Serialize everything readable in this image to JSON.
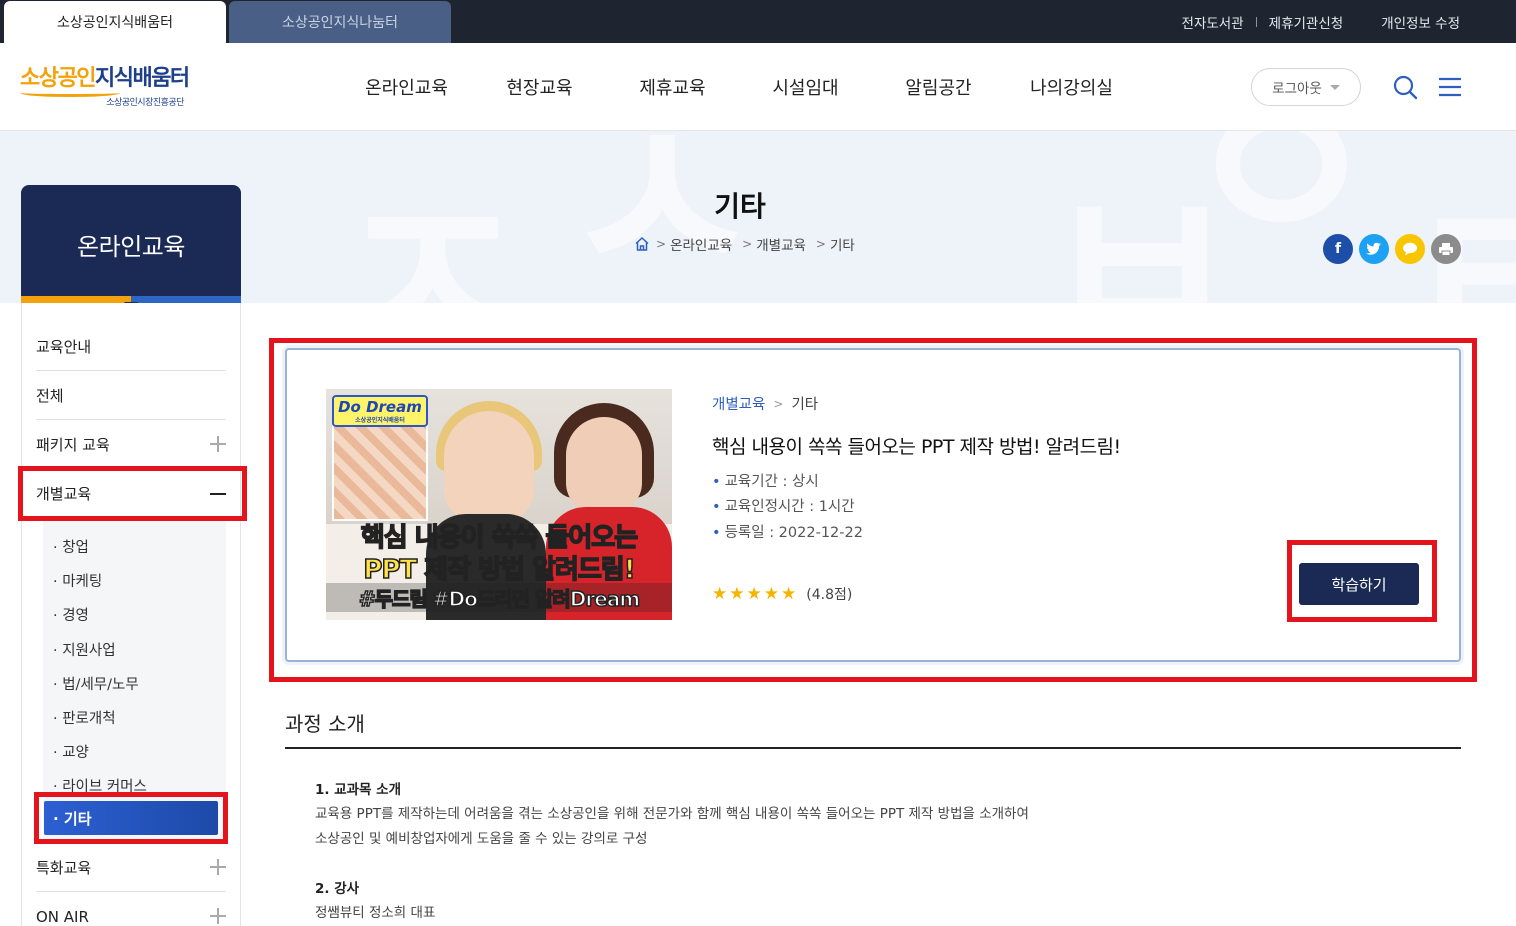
{
  "top_tabs": [
    {
      "label": "소상공인지식배움터",
      "active": true
    },
    {
      "label": "소상공인지식나눔터",
      "active": false
    }
  ],
  "top_links": [
    "전자도서관",
    "제휴기관신청",
    "개인정보 수정"
  ],
  "logo": {
    "part1": "소상공인",
    "part2": "지식배움터",
    "sub": "소상공인시장진흥공단"
  },
  "gnb": [
    "온라인교육",
    "현장교육",
    "제휴교육",
    "시설임대",
    "알림공간",
    "나의강의실"
  ],
  "logout_label": "로그아웃",
  "page": {
    "title": "기타",
    "breadcrumb": [
      "온라인교육",
      "개별교육",
      "기타"
    ]
  },
  "share_icons": [
    "facebook-icon",
    "twitter-icon",
    "kakao-icon",
    "print-icon"
  ],
  "sidebar": {
    "title": "온라인교육",
    "items": [
      {
        "label": "교육안내",
        "expand": "none"
      },
      {
        "label": "전체",
        "expand": "none"
      },
      {
        "label": "패키지 교육",
        "expand": "plus"
      },
      {
        "label": "개별교육",
        "expand": "minus"
      },
      {
        "label": "특화교육",
        "expand": "plus"
      },
      {
        "label": "ON AIR",
        "expand": "plus"
      }
    ],
    "sub_items": [
      "· 창업",
      "· 마케팅",
      "· 경영",
      "· 지원사업",
      "· 법/세무/노무",
      "· 판로개척",
      "· 교양",
      "· 라이브 커머스"
    ],
    "sub_active": "· 기타"
  },
  "course": {
    "thumbnail": {
      "badge": "Do Dream",
      "badge_sub": "소상공인지식배움터",
      "line1": "핵심 내용이 쏙쏙 들어오는",
      "line2": "PPT 제작 방법 알려드림!",
      "line3": "#두드림 #Do드리면 알려Dream"
    },
    "category": "개별교육",
    "subcategory": "기타",
    "title": "핵심 내용이 쏙쏙 들어오는 PPT 제작 방법! 알려드림!",
    "meta": [
      "교육기간 : 상시",
      "교육인정시간 : 1시간",
      "등록일 : 2022-12-22"
    ],
    "rating_stars": 5,
    "rating_text": "(4.8점)",
    "study_button": "학습하기"
  },
  "intro": {
    "title": "과정 소개",
    "section1_title": "1. 교과목 소개",
    "section1_line1": "교육용 PPT를 제작하는데 어려움을 겪는 소상공인을 위해 전문가와 함께 핵심 내용이 쏙쏙 들어오는 PPT 제작 방법을 소개하여",
    "section1_line2": "소상공인 및 예비창업자에게 도움을 줄 수 있는 강의로 구성",
    "section2_title": "2. 강사",
    "section2_line1": "정쌤뷰티 정소희 대표"
  },
  "colors": {
    "navy": "#1a2a55",
    "accent_orange": "#f2a20c",
    "accent_blue": "#2e5fbf",
    "highlight_red": "#e3141c",
    "topbar": "#1e2531"
  }
}
